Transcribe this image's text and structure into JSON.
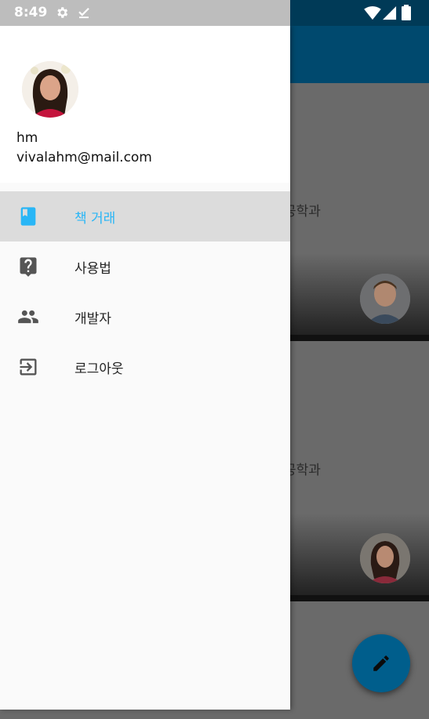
{
  "status_bar": {
    "time": "8:49"
  },
  "drawer": {
    "user": {
      "name": "hm",
      "email": "vivalahm@mail.com"
    },
    "menu": [
      {
        "label": "책 거래",
        "icon": "book-icon",
        "active": true
      },
      {
        "label": "사용법",
        "icon": "help-icon",
        "active": false
      },
      {
        "label": "개발자",
        "icon": "people-icon",
        "active": false
      },
      {
        "label": "로그아웃",
        "icon": "logout-icon",
        "active": false
      }
    ]
  },
  "background": {
    "cards": [
      {
        "department": "공학과"
      },
      {
        "department": "공학과"
      }
    ],
    "fab_icon": "pencil-icon"
  },
  "colors": {
    "accent": "#29b6f6",
    "toolbar": "#00496e",
    "fab": "#005e8c"
  }
}
